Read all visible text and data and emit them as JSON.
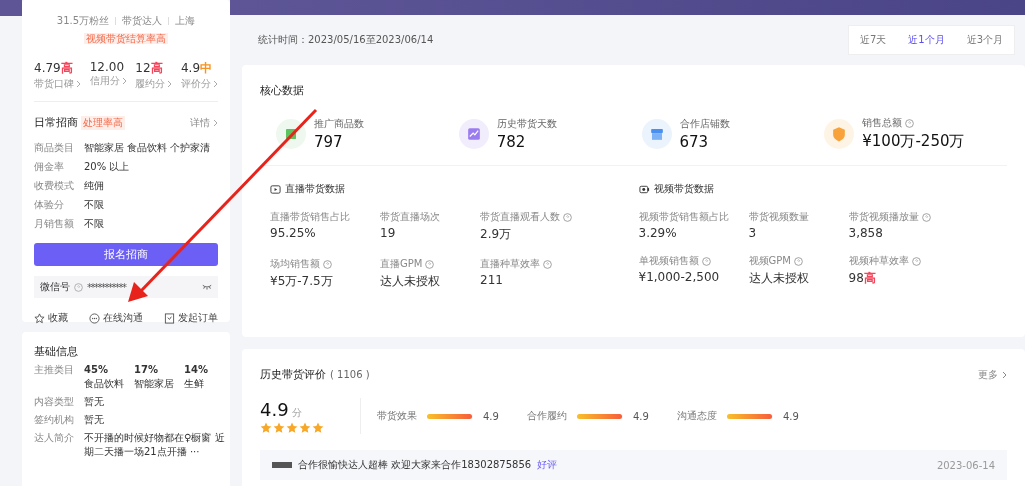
{
  "profile": {
    "meta": [
      "31.5万粉丝",
      "带货达人",
      "上海"
    ],
    "tag": "视频带货结算率高",
    "scores": [
      {
        "value": "4.79",
        "grade": "高",
        "color": "#f5455a",
        "label": "带货口碑"
      },
      {
        "value": "12.00",
        "label": "信用分"
      },
      {
        "value": "12",
        "grade": "高",
        "color": "#f5455a",
        "label": "履约分"
      },
      {
        "value": "4.9",
        "grade": "中",
        "color": "#f7931e",
        "label": "评价分"
      }
    ]
  },
  "recruit": {
    "title": "日常招商",
    "tag": "处理率高",
    "link": "详情",
    "rows": [
      {
        "label": "商品类目",
        "value": "智能家居 食品饮料 个护家清"
      },
      {
        "label": "佣金率",
        "value": "20% 以上"
      },
      {
        "label": "收费模式",
        "value": "纯佣"
      },
      {
        "label": "体验分",
        "value": "不限"
      },
      {
        "label": "月销售额",
        "value": "不限"
      }
    ],
    "button": "报名招商",
    "wechat": {
      "label": "微信号",
      "value": "***********"
    },
    "actions": [
      {
        "kind": "star",
        "label": "收藏"
      },
      {
        "kind": "chat",
        "label": "在线沟通"
      },
      {
        "kind": "order",
        "label": "发起订单"
      }
    ]
  },
  "basic": {
    "title": "基础信息",
    "category_label": "主推类目",
    "categories": [
      {
        "share": "45%",
        "name": "食品饮料"
      },
      {
        "share": "17%",
        "name": "智能家居"
      },
      {
        "share": "14%",
        "name": "生鲜"
      }
    ],
    "rows": [
      {
        "label": "内容类型",
        "lines": [
          "暂无"
        ]
      },
      {
        "label": "签约机构",
        "lines": [
          "暂无"
        ]
      },
      {
        "label": "达人简介",
        "lines": [
          "不开播的时候好物都在♀橱窗 近",
          "期二天播一场21点开播 ···"
        ]
      }
    ]
  },
  "period": {
    "text": "统计时间：2023/05/16至2023/06/14",
    "options": [
      {
        "label": "近7天",
        "selected": false
      },
      {
        "label": "近1个月",
        "selected": true
      },
      {
        "label": "近3个月",
        "selected": false
      }
    ]
  },
  "core": {
    "title": "核心数据",
    "metrics": [
      {
        "kind": "product",
        "label": "推广商品数",
        "value": "797",
        "help": false
      },
      {
        "kind": "days",
        "label": "历史带货天数",
        "value": "782",
        "help": false
      },
      {
        "kind": "shop",
        "label": "合作店铺数",
        "value": "673",
        "help": false
      },
      {
        "kind": "sales",
        "label": "销售总额",
        "value": "¥100万-250万",
        "help": true
      }
    ]
  },
  "sections": [
    {
      "kind": "live",
      "title": "直播带货数据",
      "metrics": [
        {
          "label": "直播带货销售占比",
          "value": "95.25%",
          "help": false
        },
        {
          "label": "带货直播场次",
          "value": "19",
          "help": false
        },
        {
          "label": "带货直播观看人数",
          "value": "2.9万",
          "help": true
        },
        {
          "label": "场均销售额",
          "value": "¥5万-7.5万",
          "help": true
        },
        {
          "label": "直播GPM",
          "value": "达人未授权",
          "help": true
        },
        {
          "label": "直播种草效率",
          "value": "211",
          "help": true
        }
      ]
    },
    {
      "kind": "video",
      "title": "视频带货数据",
      "metrics": [
        {
          "label": "视频带货销售额占比",
          "value": "3.29%",
          "help": false
        },
        {
          "label": "带货视频数量",
          "value": "3",
          "help": false
        },
        {
          "label": "带货视频播放量",
          "value": "3,858",
          "help": true
        },
        {
          "label": "单视频销售额",
          "value": "¥1,000-2,500",
          "help": true
        },
        {
          "label": "视频GPM",
          "value": "达人未授权",
          "help": true
        },
        {
          "label": "视频种草效率",
          "value": "98",
          "grade": "高",
          "color": "#f5455a",
          "help": true
        }
      ]
    }
  ],
  "reviews": {
    "title": "历史带货评价",
    "count": "( 1106 )",
    "more": "更多",
    "score": "4.9",
    "unit": "分",
    "stars": 5,
    "bars": [
      {
        "label": "带货效果",
        "level": 0.98,
        "value": "4.9"
      },
      {
        "label": "合作履约",
        "level": 0.98,
        "value": "4.9"
      },
      {
        "label": "沟通态度",
        "level": 0.98,
        "value": "4.9"
      }
    ],
    "comment": {
      "text": "合作很愉快达人超棒 欢迎大家来合作18302875856",
      "tag": "好评",
      "date": "2023-06-14"
    }
  }
}
